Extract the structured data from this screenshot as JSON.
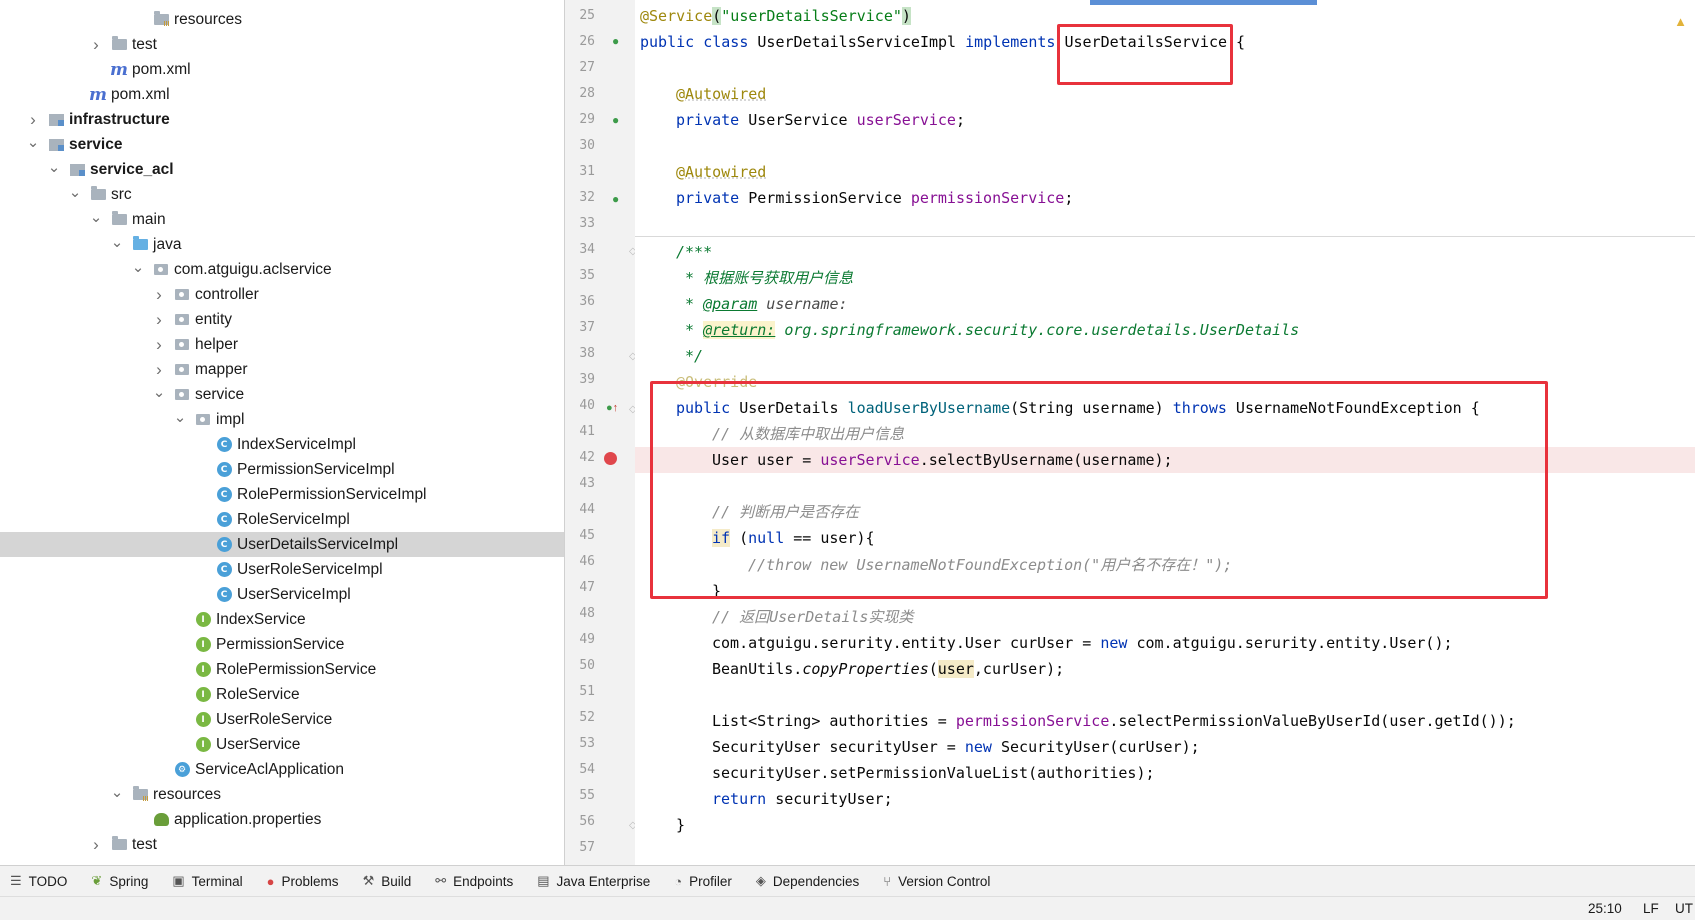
{
  "project_tree": {
    "rows": [
      {
        "label": "resources",
        "icon": "resources-folder-icon",
        "depth": 6,
        "arrow": "none"
      },
      {
        "label": "test",
        "icon": "folder-icon",
        "depth": 4,
        "arrow": "right"
      },
      {
        "label": "pom.xml",
        "icon": "maven-icon",
        "depth": 4,
        "arrow": "none"
      },
      {
        "label": "pom.xml",
        "icon": "maven-icon",
        "depth": 3,
        "arrow": "none"
      },
      {
        "label": "infrastructure",
        "icon": "module-folder-icon",
        "depth": 1,
        "arrow": "right",
        "bold": true
      },
      {
        "label": "service",
        "icon": "module-folder-icon",
        "depth": 1,
        "arrow": "down",
        "bold": true
      },
      {
        "label": "service_acl",
        "icon": "module-folder-icon",
        "depth": 2,
        "arrow": "down",
        "bold": true
      },
      {
        "label": "src",
        "icon": "folder-icon",
        "depth": 3,
        "arrow": "down"
      },
      {
        "label": "main",
        "icon": "folder-icon",
        "depth": 4,
        "arrow": "down"
      },
      {
        "label": "java",
        "icon": "source-folder-icon",
        "depth": 5,
        "arrow": "down"
      },
      {
        "label": "com.atguigu.aclservice",
        "icon": "package-icon",
        "depth": 6,
        "arrow": "down"
      },
      {
        "label": "controller",
        "icon": "package-icon",
        "depth": 7,
        "arrow": "right"
      },
      {
        "label": "entity",
        "icon": "package-icon",
        "depth": 7,
        "arrow": "right"
      },
      {
        "label": "helper",
        "icon": "package-icon",
        "depth": 7,
        "arrow": "right"
      },
      {
        "label": "mapper",
        "icon": "package-icon",
        "depth": 7,
        "arrow": "right"
      },
      {
        "label": "service",
        "icon": "package-icon",
        "depth": 7,
        "arrow": "down"
      },
      {
        "label": "impl",
        "icon": "package-icon",
        "depth": 8,
        "arrow": "down"
      },
      {
        "label": "IndexServiceImpl",
        "icon": "class-icon",
        "depth": 9,
        "arrow": "none"
      },
      {
        "label": "PermissionServiceImpl",
        "icon": "class-icon",
        "depth": 9,
        "arrow": "none"
      },
      {
        "label": "RolePermissionServiceImpl",
        "icon": "class-icon",
        "depth": 9,
        "arrow": "none"
      },
      {
        "label": "RoleServiceImpl",
        "icon": "class-icon",
        "depth": 9,
        "arrow": "none"
      },
      {
        "label": "UserDetailsServiceImpl",
        "icon": "class-icon",
        "depth": 9,
        "arrow": "none",
        "selected": true
      },
      {
        "label": "UserRoleServiceImpl",
        "icon": "class-icon",
        "depth": 9,
        "arrow": "none"
      },
      {
        "label": "UserServiceImpl",
        "icon": "class-icon",
        "depth": 9,
        "arrow": "none"
      },
      {
        "label": "IndexService",
        "icon": "interface-icon",
        "depth": 8,
        "arrow": "none"
      },
      {
        "label": "PermissionService",
        "icon": "interface-icon",
        "depth": 8,
        "arrow": "none"
      },
      {
        "label": "RolePermissionService",
        "icon": "interface-icon",
        "depth": 8,
        "arrow": "none"
      },
      {
        "label": "RoleService",
        "icon": "interface-icon",
        "depth": 8,
        "arrow": "none"
      },
      {
        "label": "UserRoleService",
        "icon": "interface-icon",
        "depth": 8,
        "arrow": "none"
      },
      {
        "label": "UserService",
        "icon": "interface-icon",
        "depth": 8,
        "arrow": "none"
      },
      {
        "label": "ServiceAclApplication",
        "icon": "spring-app-icon",
        "depth": 7,
        "arrow": "none"
      },
      {
        "label": "resources",
        "icon": "resources-folder-icon",
        "depth": 5,
        "arrow": "down"
      },
      {
        "label": "application.properties",
        "icon": "properties-icon",
        "depth": 6,
        "arrow": "none"
      },
      {
        "label": "test",
        "icon": "folder-icon",
        "depth": 4,
        "arrow": "right"
      }
    ]
  },
  "editor": {
    "line_numbers": [
      "25",
      "26",
      "27",
      "28",
      "29",
      "30",
      "31",
      "32",
      "33",
      "34",
      "35",
      "36",
      "37",
      "38",
      "39",
      "40",
      "41",
      "42",
      "43",
      "44",
      "45",
      "46",
      "47",
      "48",
      "49",
      "50",
      "51",
      "52",
      "53",
      "54",
      "55",
      "56",
      "57"
    ],
    "code": {
      "l25_ann": "@Service",
      "l25_paren_open": "(",
      "l25_str": "\"userDetailsService\"",
      "l25_paren_close": ")",
      "l26_kw": "public class",
      "l26_name": " UserDetailsServiceImpl ",
      "l26_impl": "implements",
      "l26_iface": "UserDetailsService",
      "l26_brace": " {",
      "l28_ann": "@Autowired",
      "l29_kw": "private",
      "l29_type": " UserService ",
      "l29_field": "userService",
      "l29_end": ";",
      "l31_ann": "@Autowired",
      "l32_kw": "private",
      "l32_type": " PermissionService ",
      "l32_field": "permissionService",
      "l32_end": ";",
      "l34": "/***",
      "l35": " * 根据账号获取用户信息",
      "l36_pre": " * ",
      "l36_tag": "@param",
      "l36_rest": " username:",
      "l37_pre": " * ",
      "l37_tag": "@return:",
      "l37_rest": " org.springframework.security.core.userdetails.UserDetails",
      "l38": " */",
      "l39": "@Override",
      "l40_kw": "public",
      "l40_type": " UserDetails ",
      "l40_method": "loadUserByUsername",
      "l40_params": "(String username) ",
      "l40_throws": "throws",
      "l40_exc": " UsernameNotFoundException {",
      "l41": "// 从数据库中取出用户信息",
      "l42_pre": "User user = ",
      "l42_field": "userService",
      "l42_rest": ".selectByUsername(username);",
      "l44": "// 判断用户是否存在",
      "l45_if": "if",
      "l45_pre": " (",
      "l45_null": "null",
      "l45_rest": " == user){",
      "l46": "//throw new UsernameNotFoundException(\"用户名不存在！\");",
      "l47": "}",
      "l48": "// 返回UserDetails实现类",
      "l49_pre": "com.atguigu.serurity.entity.User curUser = ",
      "l49_new": "new",
      "l49_rest": " com.atguigu.serurity.entity.User();",
      "l50_pre": "BeanUtils.",
      "l50_method": "copyProperties",
      "l50_open": "(",
      "l50_user": "user",
      "l50_rest": ",curUser);",
      "l52_pre": "List<String> authorities = ",
      "l52_field": "permissionService",
      "l52_rest": ".selectPermissionValueByUserId(user.getId());",
      "l53_pre": "SecurityUser securityUser = ",
      "l53_new": "new",
      "l53_rest": " SecurityUser(curUser);",
      "l54": "securityUser.setPermissionValueList(authorities);",
      "l55_kw": "return",
      "l55_rest": " securityUser;",
      "l56": "}"
    },
    "warning_icon": "warning-icon"
  },
  "bottom_toolbar": [
    {
      "label": "TODO",
      "icon": "list-icon"
    },
    {
      "label": "Spring",
      "icon": "spring-icon"
    },
    {
      "label": "Terminal",
      "icon": "terminal-icon"
    },
    {
      "label": "Problems",
      "icon": "error-icon"
    },
    {
      "label": "Build",
      "icon": "hammer-icon"
    },
    {
      "label": "Endpoints",
      "icon": "endpoints-icon"
    },
    {
      "label": "Java Enterprise",
      "icon": "java-enterprise-icon"
    },
    {
      "label": "Profiler",
      "icon": "profiler-icon"
    },
    {
      "label": "Dependencies",
      "icon": "dependencies-icon"
    },
    {
      "label": "Version Control",
      "icon": "version-control-icon"
    }
  ],
  "status_bar": {
    "position": "25:10",
    "line_ending": "LF",
    "encoding": "UT"
  },
  "colors": {
    "keyword": "#0033b3",
    "annotation": "#9e880d",
    "string": "#067d17",
    "field": "#871094",
    "comment": "#8c8c8c",
    "highlight_box": "#e8323c",
    "breakpoint": "#e0474c"
  }
}
